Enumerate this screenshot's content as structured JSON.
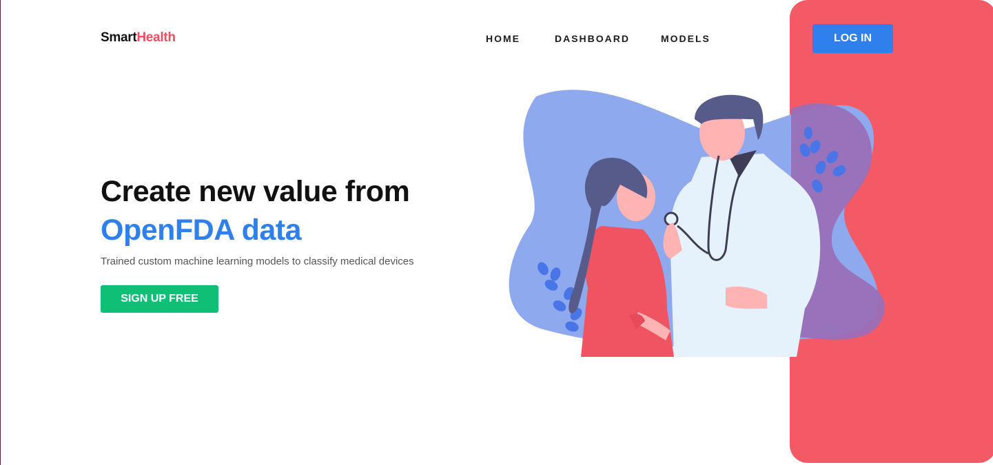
{
  "brand": {
    "name_part1": "Smart",
    "name_part2": "Health"
  },
  "nav": {
    "items": [
      {
        "label": "HOME"
      },
      {
        "label": "DASHBOARD"
      },
      {
        "label": "MODELS"
      }
    ],
    "login_label": "LOG IN"
  },
  "hero": {
    "title_line1": "Create new value from",
    "title_line2": "OpenFDA data",
    "subtitle": "Trained custom machine learning models to classify medical devices",
    "cta_label": "SIGN UP FREE"
  },
  "colors": {
    "brand_accent": "#ef4e60",
    "primary_blue": "#2f80ed",
    "cta_green": "#0fbf75",
    "panel_red": "#f35a66",
    "blob_blue": "#8fa9ee",
    "blob_purple": "#9a6fb8"
  },
  "icons": {
    "illustration": "doctor-with-patient-illustration"
  }
}
